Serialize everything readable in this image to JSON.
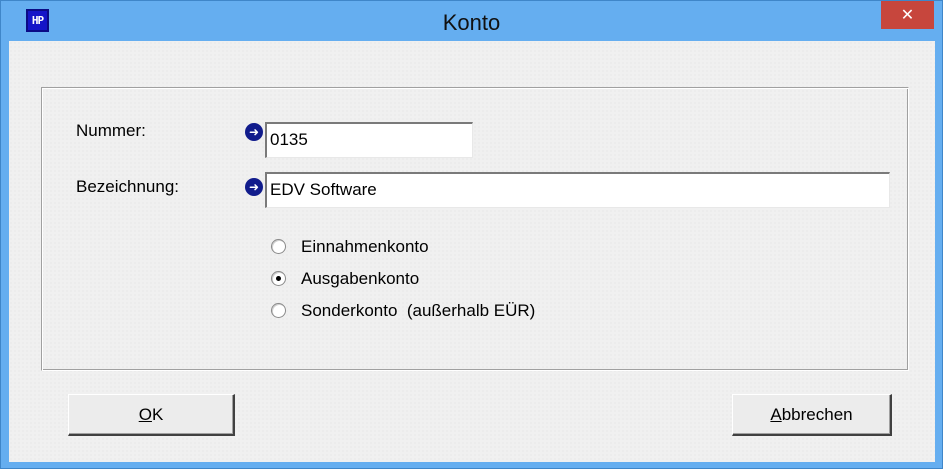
{
  "window": {
    "title": "Konto",
    "app_icon_text": "HP",
    "close_glyph": "✕"
  },
  "form": {
    "nummer_label": "Nummer:",
    "nummer_value": "0135",
    "bezeichnung_label": "Bezeichnung:",
    "bezeichnung_value": "EDV Software",
    "arrow_icon": "arrow-right-circle-icon"
  },
  "account_types": {
    "selected": "Ausgabenkonto",
    "options": [
      {
        "label": "Einnahmenkonto",
        "checked": false
      },
      {
        "label": "Ausgabenkonto",
        "checked": true
      },
      {
        "label": "Sonderkonto  (außerhalb EÜR)",
        "checked": false
      }
    ]
  },
  "buttons": {
    "ok_mnemonic": "O",
    "ok_rest": "K",
    "cancel_mnemonic": "A",
    "cancel_rest": "bbrechen"
  },
  "colors": {
    "titlebar": "#65aef0",
    "close_button": "#c7463d",
    "arrow_icon": "#111c8c",
    "dialog_background": "#f0f0f0"
  }
}
